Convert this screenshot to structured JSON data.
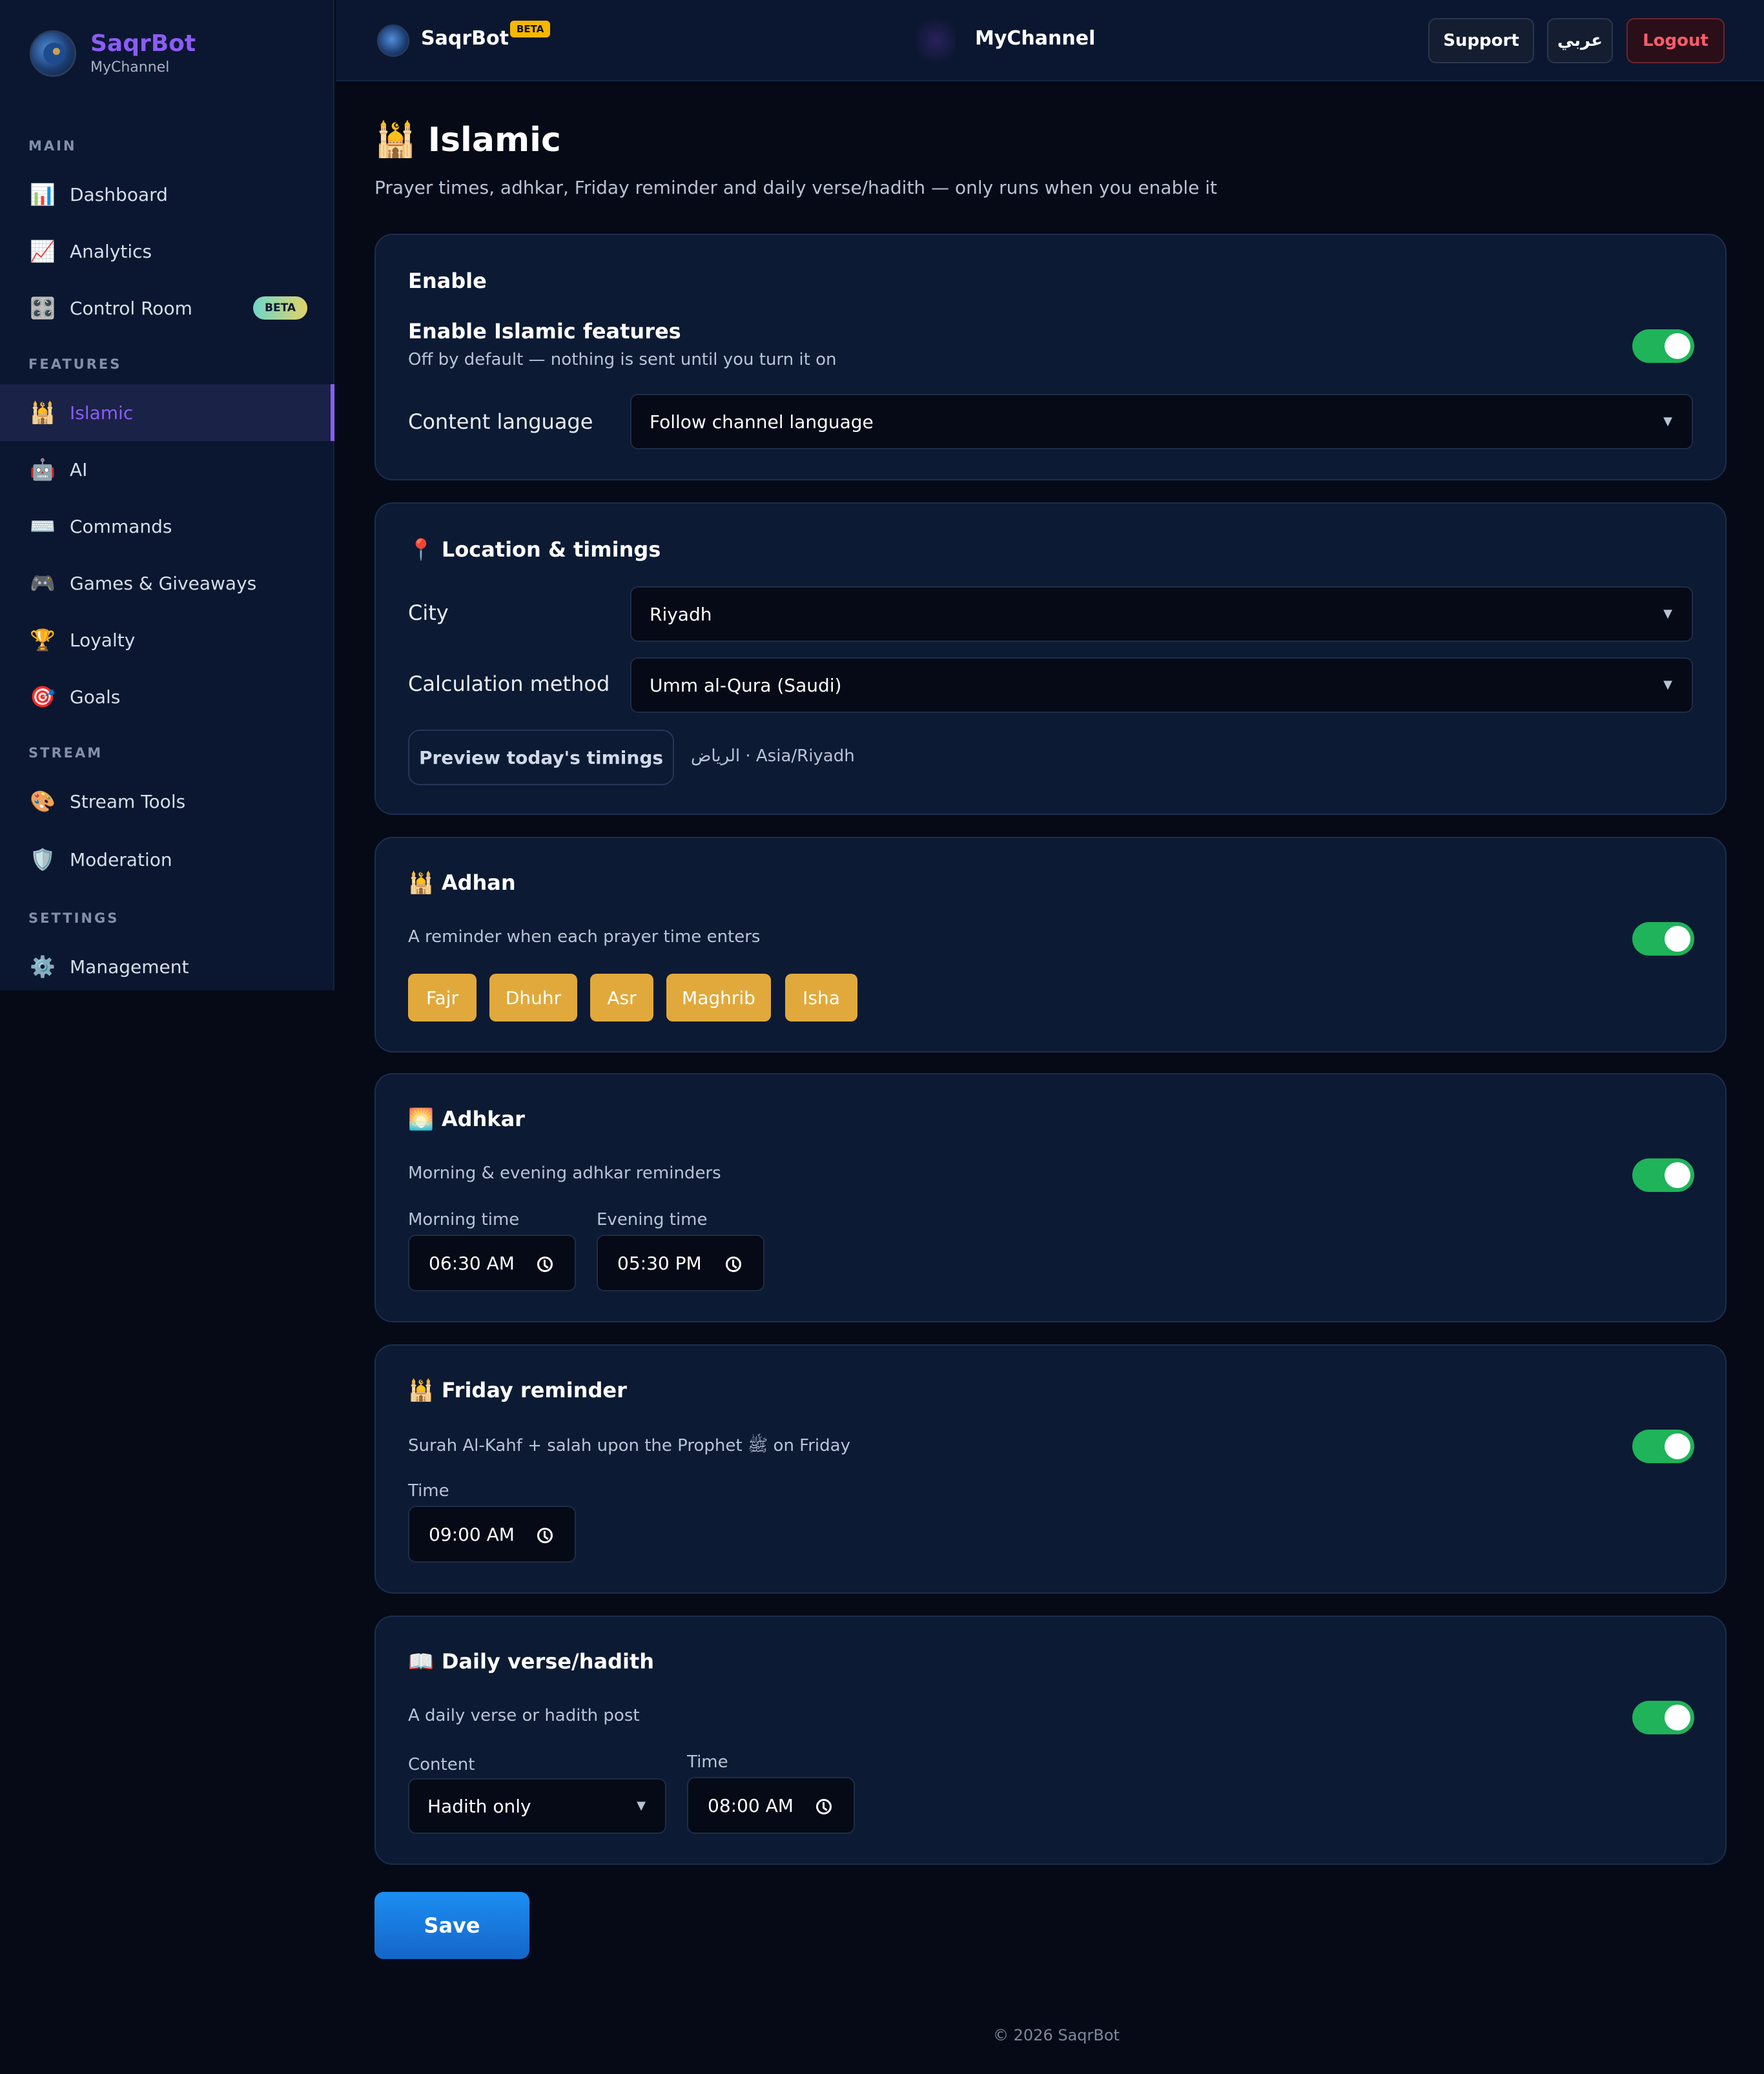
{
  "brand": {
    "name": "SaqrBot",
    "channel": "MyChannel"
  },
  "sidebar": {
    "sections": {
      "main": "MAIN",
      "features": "FEATURES",
      "stream": "STREAM",
      "settings": "SETTINGS"
    },
    "items": [
      {
        "label": "Dashboard",
        "icon": "📊"
      },
      {
        "label": "Analytics",
        "icon": "📈"
      },
      {
        "label": "Control Room",
        "icon": "🎛️",
        "badge": "BETA"
      },
      {
        "label": "Islamic",
        "icon": "🕌",
        "active": true
      },
      {
        "label": "AI",
        "icon": "🤖"
      },
      {
        "label": "Commands",
        "icon": "⌨️"
      },
      {
        "label": "Games & Giveaways",
        "icon": "🎮"
      },
      {
        "label": "Loyalty",
        "icon": "🏆"
      },
      {
        "label": "Goals",
        "icon": "🎯"
      },
      {
        "label": "Stream Tools",
        "icon": "🎨"
      },
      {
        "label": "Moderation",
        "icon": "🛡️"
      },
      {
        "label": "Management",
        "icon": "⚙️"
      }
    ]
  },
  "topbar": {
    "name": "SaqrBot",
    "beta": "BETA",
    "channel": "MyChannel",
    "support": "Support",
    "language": "عربي",
    "logout": "Logout"
  },
  "page": {
    "icon": "🕌",
    "title": "Islamic",
    "subtitle": "Prayer times, adhkar, Friday reminder and daily verse/hadith — only runs when you enable it"
  },
  "enable_card": {
    "title": "Enable",
    "feature_label": "Enable Islamic features",
    "feature_desc": "Off by default — nothing is sent until you turn it on",
    "enabled": true,
    "language_label": "Content language",
    "language_value": "Follow channel language"
  },
  "location_card": {
    "icon": "📍",
    "title": "Location & timings",
    "city_label": "City",
    "city_value": "Riyadh",
    "method_label": "Calculation method",
    "method_value": "Umm al-Qura (Saudi)",
    "preview_button": "Preview today's timings",
    "preview_info": "الرياض · Asia/Riyadh"
  },
  "adhan_card": {
    "icon": "🕌",
    "title": "Adhan",
    "desc": "A reminder when each prayer time enters",
    "enabled": true,
    "prayers": [
      "Fajr",
      "Dhuhr",
      "Asr",
      "Maghrib",
      "Isha"
    ]
  },
  "adhkar_card": {
    "icon": "🌅",
    "title": "Adhkar",
    "desc": "Morning & evening adhkar reminders",
    "enabled": true,
    "morning_label": "Morning time",
    "morning_value": "06:30 AM",
    "evening_label": "Evening time",
    "evening_value": "05:30 PM"
  },
  "friday_card": {
    "icon": "🕌",
    "title": "Friday reminder",
    "desc": "Surah Al-Kahf + salah upon the Prophet ﷺ on Friday",
    "enabled": true,
    "time_label": "Time",
    "time_value": "09:00 AM"
  },
  "daily_card": {
    "icon": "📖",
    "title": "Daily verse/hadith",
    "desc": "A daily verse or hadith post",
    "enabled": true,
    "content_label": "Content",
    "content_value": "Hadith only",
    "time_label": "Time",
    "time_value": "08:00 AM"
  },
  "save_label": "Save",
  "footer": "© 2026 SaqrBot",
  "colors": {
    "accent": "#8b5cf6",
    "toggle_on": "#1fb35a",
    "chip": "#e1a93b",
    "save": "#1c8ef2",
    "logout": "#ff5c6c"
  }
}
